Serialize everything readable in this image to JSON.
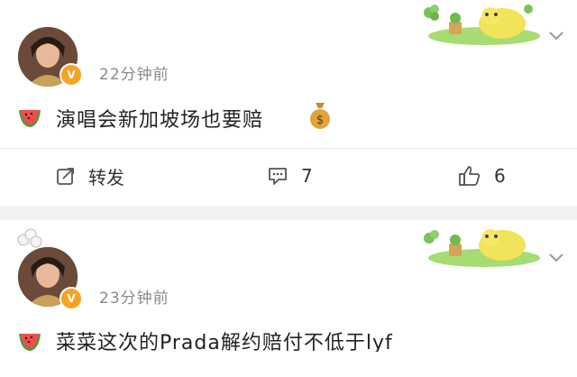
{
  "posts": [
    {
      "time": "22分钟前",
      "content": "演唱会新加坡场也要赔",
      "emoji_after": "money-bag-icon",
      "actions": {
        "share_label": "转发",
        "comment_count": "7",
        "like_count": "6"
      }
    },
    {
      "time": "23分钟前",
      "content": "菜菜这次的Prada解约赔付不低于lyf",
      "emoji_after": ""
    }
  ],
  "colors": {
    "badge": "#f7a321",
    "decor_green": "#9fd36a",
    "decor_yellow": "#f4e15c",
    "text_muted": "#8a8a8a",
    "separator": "#f2f2f2"
  },
  "icons": {
    "watermelon": "watermelon-icon",
    "share": "share-icon",
    "comment": "comment-icon",
    "like": "thumbs-up-icon",
    "expand": "chevron-down-icon"
  }
}
